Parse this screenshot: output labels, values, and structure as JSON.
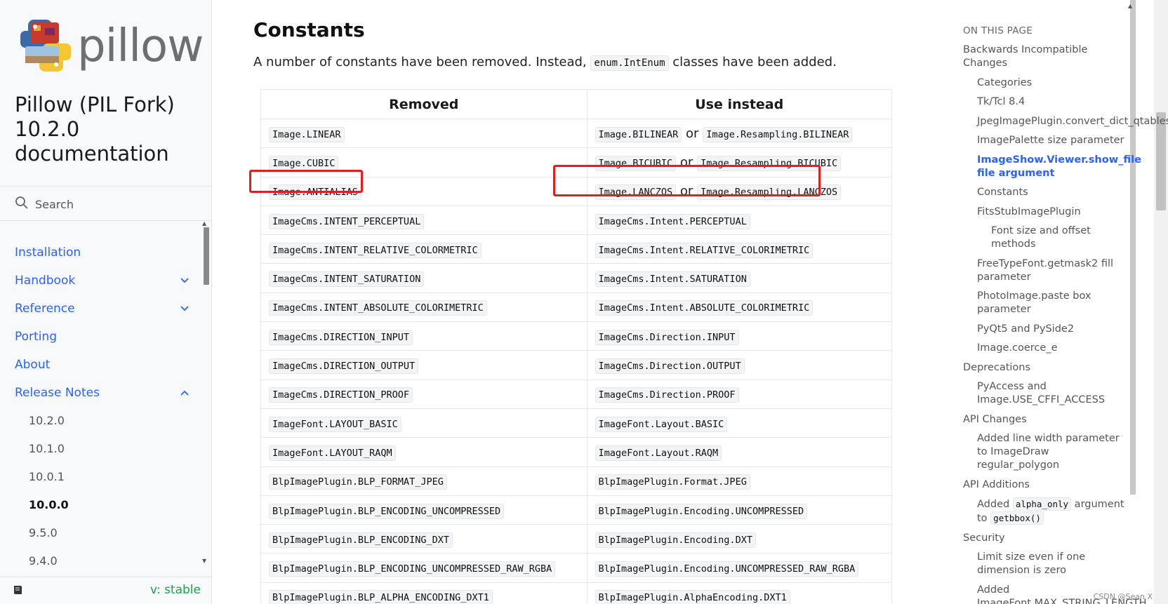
{
  "sidebar": {
    "logo_text": "pillow",
    "project_title": "Pillow (PIL Fork) 10.2.0 documentation",
    "search_placeholder": "Search",
    "nav": [
      {
        "label": "Installation",
        "expandable": false
      },
      {
        "label": "Handbook",
        "expandable": true,
        "expanded": false
      },
      {
        "label": "Reference",
        "expandable": true,
        "expanded": false
      },
      {
        "label": "Porting",
        "expandable": false
      },
      {
        "label": "About",
        "expandable": false
      },
      {
        "label": "Release Notes",
        "expandable": true,
        "expanded": true
      }
    ],
    "release_versions": [
      "10.2.0",
      "10.1.0",
      "10.0.1",
      "10.0.0",
      "9.5.0",
      "9.4.0"
    ],
    "current_version": "10.0.0",
    "version_selector": "v: stable"
  },
  "main": {
    "heading": "Constants",
    "intro_before": "A number of constants have been removed. Instead,",
    "intro_code": "enum.IntEnum",
    "intro_after": "classes have been added.",
    "table": {
      "headers": [
        "Removed",
        "Use instead"
      ],
      "or_word": "or",
      "rows": [
        {
          "removed": "Image.LINEAR",
          "use": "Image.BILINEAR",
          "alt": "Image.Resampling.BILINEAR"
        },
        {
          "removed": "Image.CUBIC",
          "use": "Image.BICUBIC",
          "alt": "Image.Resampling.BICUBIC"
        },
        {
          "removed": "Image.ANTIALIAS",
          "use": "Image.LANCZOS",
          "alt": "Image.Resampling.LANCZOS",
          "highlighted": true
        },
        {
          "removed": "ImageCms.INTENT_PERCEPTUAL",
          "use": "ImageCms.Intent.PERCEPTUAL"
        },
        {
          "removed": "ImageCms.INTENT_RELATIVE_COLORMETRIC",
          "use": "ImageCms.Intent.RELATIVE_COLORIMETRIC"
        },
        {
          "removed": "ImageCms.INTENT_SATURATION",
          "use": "ImageCms.Intent.SATURATION"
        },
        {
          "removed": "ImageCms.INTENT_ABSOLUTE_COLORIMETRIC",
          "use": "ImageCms.Intent.ABSOLUTE_COLORIMETRIC"
        },
        {
          "removed": "ImageCms.DIRECTION_INPUT",
          "use": "ImageCms.Direction.INPUT"
        },
        {
          "removed": "ImageCms.DIRECTION_OUTPUT",
          "use": "ImageCms.Direction.OUTPUT"
        },
        {
          "removed": "ImageCms.DIRECTION_PROOF",
          "use": "ImageCms.Direction.PROOF"
        },
        {
          "removed": "ImageFont.LAYOUT_BASIC",
          "use": "ImageFont.Layout.BASIC"
        },
        {
          "removed": "ImageFont.LAYOUT_RAQM",
          "use": "ImageFont.Layout.RAQM"
        },
        {
          "removed": "BlpImagePlugin.BLP_FORMAT_JPEG",
          "use": "BlpImagePlugin.Format.JPEG"
        },
        {
          "removed": "BlpImagePlugin.BLP_ENCODING_UNCOMPRESSED",
          "use": "BlpImagePlugin.Encoding.UNCOMPRESSED"
        },
        {
          "removed": "BlpImagePlugin.BLP_ENCODING_DXT",
          "use": "BlpImagePlugin.Encoding.DXT"
        },
        {
          "removed": "BlpImagePlugin.BLP_ENCODING_UNCOMPRESSED_RAW_RGBA",
          "use": "BlpImagePlugin.Encoding.UNCOMPRESSED_RAW_RGBA"
        },
        {
          "removed": "BlpImagePlugin.BLP_ALPHA_ENCODING_DXT1",
          "use": "BlpImagePlugin.AlphaEncoding.DXT1"
        }
      ]
    }
  },
  "toc": {
    "title": "ON THIS PAGE",
    "items": [
      {
        "label": "Backwards Incompatible Changes",
        "level": 1
      },
      {
        "label": "Categories",
        "level": 2
      },
      {
        "label": "Tk/Tcl 8.4",
        "level": 2
      },
      {
        "label": "JpegImagePlugin.convert_dict_qtables",
        "level": 2
      },
      {
        "label": "ImagePalette size parameter",
        "level": 2
      },
      {
        "label": "ImageShow.Viewer.show_file file argument",
        "level": 2,
        "active": true
      },
      {
        "label": "Constants",
        "level": 2
      },
      {
        "label": "FitsStubImagePlugin",
        "level": 2
      },
      {
        "label": "Font size and offset methods",
        "level": 3
      },
      {
        "label": "FreeTypeFont.getmask2 fill parameter",
        "level": 2
      },
      {
        "label": "PhotoImage.paste box parameter",
        "level": 2
      },
      {
        "label": "PyQt5 and PySide2",
        "level": 2
      },
      {
        "label": "Image.coerce_e",
        "level": 2
      },
      {
        "label": "Deprecations",
        "level": 1
      },
      {
        "label": "PyAccess and Image.USE_CFFI_ACCESS",
        "level": 2
      },
      {
        "label": "API Changes",
        "level": 1
      },
      {
        "label": "Added line width parameter to ImageDraw regular_polygon",
        "level": 2
      },
      {
        "label": "API Additions",
        "level": 1
      },
      {
        "label": "Added alpha_only argument to getbbox()",
        "level": 2,
        "parts": [
          "Added ",
          "alpha_only",
          " argument to ",
          "getbbox()"
        ]
      },
      {
        "label": "Security",
        "level": 1
      },
      {
        "label": "Limit size even if one dimension is zero",
        "level": 2
      },
      {
        "label": "Added ImageFont.MAX_STRING_LENGTH",
        "level": 2
      }
    ]
  },
  "watermark": "CSDN @Sean X",
  "colors": {
    "link": "#2962ff",
    "highlight_box": "#e02020",
    "version": "#17a34a"
  }
}
